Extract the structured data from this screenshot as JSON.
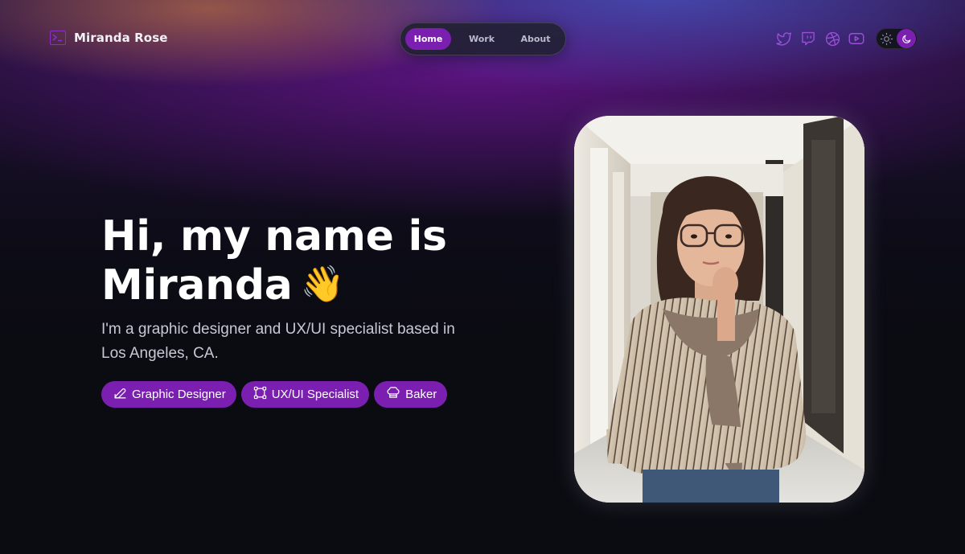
{
  "header": {
    "logo_name": "Miranda Rose",
    "nav": [
      {
        "label": "Home",
        "active": true
      },
      {
        "label": "Work",
        "active": false
      },
      {
        "label": "About",
        "active": false
      }
    ],
    "socials": [
      "twitter-icon",
      "twitch-icon",
      "dribbble-icon",
      "youtube-icon"
    ],
    "theme_toggle": {
      "mode": "dark"
    }
  },
  "hero": {
    "title_line1": "Hi, my name is",
    "title_line2": "Miranda",
    "title_emoji": "👋",
    "subtitle": "I'm a graphic designer and UX/UI specialist based in Los Angeles, CA.",
    "tags": [
      {
        "label": "Graphic Designer",
        "icon": "pen-tool-icon"
      },
      {
        "label": "UX/UI Specialist",
        "icon": "vector-frame-icon"
      },
      {
        "label": "Baker",
        "icon": "chef-hat-icon"
      }
    ]
  },
  "colors": {
    "accent": "#7a1fb0",
    "background": "#0b0b12",
    "text_primary": "#ffffff",
    "text_secondary": "#c6c9d6"
  }
}
